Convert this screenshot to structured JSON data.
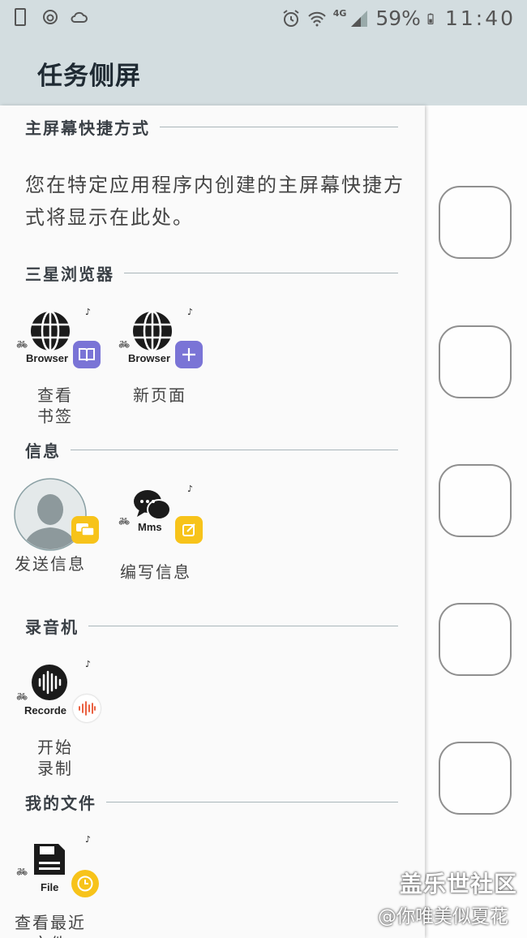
{
  "status_bar": {
    "battery": "59%",
    "time": "11:40",
    "network": "4G",
    "icons": [
      "phone-icon",
      "sync-icon",
      "cloud-icon",
      "alarm-icon",
      "wifi-icon",
      "signal-icon",
      "battery-icon"
    ]
  },
  "app_bar": {
    "title": "任务侧屏"
  },
  "sections": {
    "home_shortcuts": {
      "label": "主屏幕快捷方式",
      "description": "您在特定应用程序内创建的主屏幕快捷方式将显示在此处。"
    },
    "browser": {
      "label": "三星浏览器",
      "items": [
        {
          "app_caption": "Browser",
          "label_line1": "查看",
          "label_line2": "书签",
          "badge_icon": "book-icon"
        },
        {
          "app_caption": "Browser",
          "label_line1": "新页面",
          "label_line2": "",
          "badge_icon": "plus-icon"
        }
      ]
    },
    "messages": {
      "label": "信息",
      "items": [
        {
          "label_line1": "发送信息",
          "label_line2": "",
          "badge_icon": "chat-bubble-icon"
        },
        {
          "app_caption": "Mms",
          "label_line1": "编写信息",
          "label_line2": "",
          "badge_icon": "compose-icon"
        }
      ]
    },
    "recorder": {
      "label": "录音机",
      "items": [
        {
          "app_caption": "Recorde",
          "label_line1": "开始",
          "label_line2": "录制",
          "badge_icon": "waveform-icon"
        }
      ]
    },
    "my_files": {
      "label": "我的文件",
      "items": [
        {
          "app_caption": "File",
          "label_line1": "查看最近",
          "label_line2": "文件",
          "badge_icon": "clock-icon"
        }
      ]
    }
  },
  "watermark": {
    "line1": "盖乐世社区",
    "line2": "@你唯美似夏花"
  },
  "colors": {
    "header_bg": "#d3dde0",
    "purple_badge": "#7a74d6",
    "yellow_badge": "#f7c31a",
    "divider": "#a9b6ba"
  }
}
